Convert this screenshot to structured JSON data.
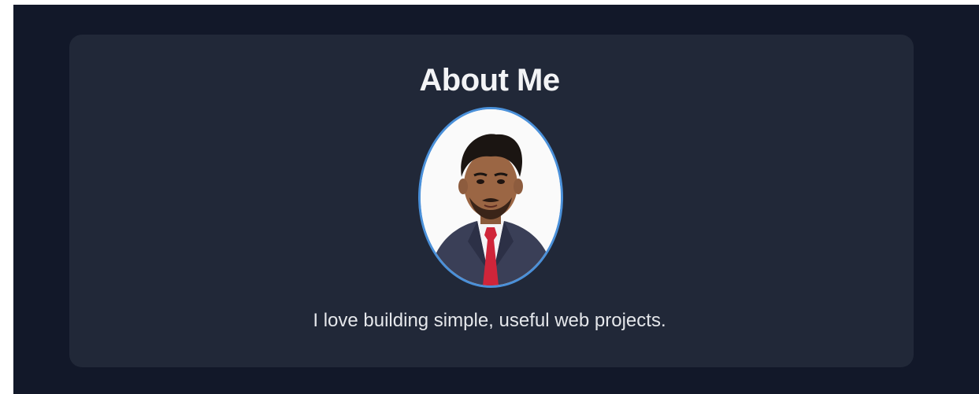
{
  "about": {
    "title": "About Me",
    "description": "I love building simple, useful web projects.",
    "avatar_alt": "profile photo"
  },
  "colors": {
    "page_background": "#121829",
    "card_background": "#212838",
    "avatar_border": "#4a90d9",
    "text": "#e5e7eb"
  }
}
